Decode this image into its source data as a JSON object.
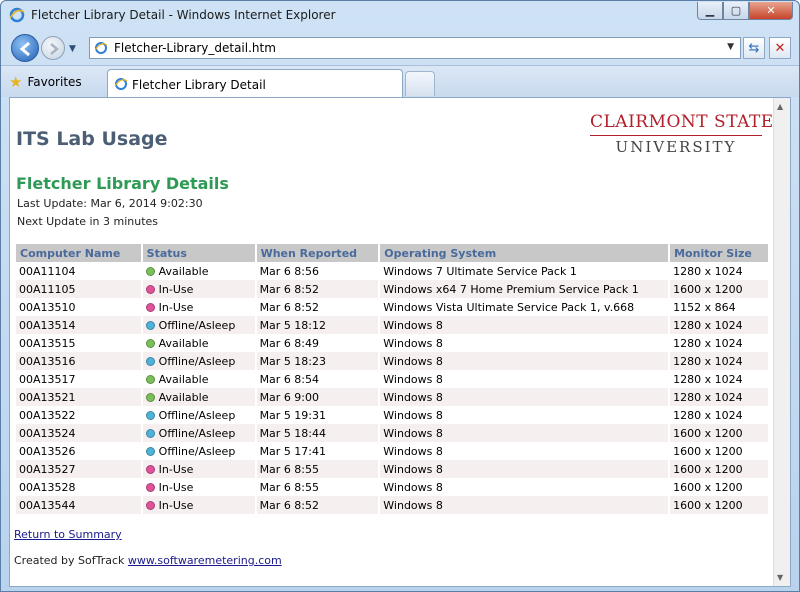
{
  "window": {
    "title": "Fletcher Library Detail - Windows Internet Explorer",
    "address": "Fletcher-Library_detail.htm",
    "favorites_label": "Favorites",
    "tab_label": "Fletcher Library Detail"
  },
  "page": {
    "heading": "ITS Lab Usage",
    "logo_line1": "CLAIRMONT STATE",
    "logo_line2": "UNIVERSITY",
    "subheading": "Fletcher Library Details",
    "last_update": "Last Update: Mar 6, 2014 9:02:30",
    "next_update": "Next Update in 3 minutes",
    "return_link": "Return to Summary",
    "created_by": "Created by SofTrack",
    "created_link": "www.softwaremetering.com"
  },
  "status_colors": {
    "Available": "#7ac05a",
    "In-Use": "#e0529a",
    "Offline/Asleep": "#4fb3d9"
  },
  "table": {
    "headers": [
      "Computer Name",
      "Status",
      "When Reported",
      "Operating System",
      "Monitor Size"
    ],
    "rows": [
      [
        "00A11104",
        "Available",
        "Mar 6 8:56",
        "Windows 7 Ultimate Service Pack 1",
        "1280 x 1024"
      ],
      [
        "00A11105",
        "In-Use",
        "Mar 6 8:52",
        "Windows x64 7 Home Premium Service Pack 1",
        "1600 x 1200"
      ],
      [
        "00A13510",
        "In-Use",
        "Mar 6 8:52",
        "Windows Vista Ultimate Service Pack 1, v.668",
        "1152 x 864"
      ],
      [
        "00A13514",
        "Offline/Asleep",
        "Mar 5 18:12",
        "Windows 8",
        "1280 x 1024"
      ],
      [
        "00A13515",
        "Available",
        "Mar 6 8:49",
        "Windows 8",
        "1280 x 1024"
      ],
      [
        "00A13516",
        "Offline/Asleep",
        "Mar 5 18:23",
        "Windows 8",
        "1280 x 1024"
      ],
      [
        "00A13517",
        "Available",
        "Mar 6 8:54",
        "Windows 8",
        "1280 x 1024"
      ],
      [
        "00A13521",
        "Available",
        "Mar 6 9:00",
        "Windows 8",
        "1280 x 1024"
      ],
      [
        "00A13522",
        "Offline/Asleep",
        "Mar 5 19:31",
        "Windows 8",
        "1280 x 1024"
      ],
      [
        "00A13524",
        "Offline/Asleep",
        "Mar 5 18:44",
        "Windows 8",
        "1600 x 1200"
      ],
      [
        "00A13526",
        "Offline/Asleep",
        "Mar 5 17:41",
        "Windows 8",
        "1600 x 1200"
      ],
      [
        "00A13527",
        "In-Use",
        "Mar 6 8:55",
        "Windows 8",
        "1600 x 1200"
      ],
      [
        "00A13528",
        "In-Use",
        "Mar 6 8:55",
        "Windows 8",
        "1600 x 1200"
      ],
      [
        "00A13544",
        "In-Use",
        "Mar 6 8:52",
        "Windows 8",
        "1600 x 1200"
      ]
    ]
  }
}
